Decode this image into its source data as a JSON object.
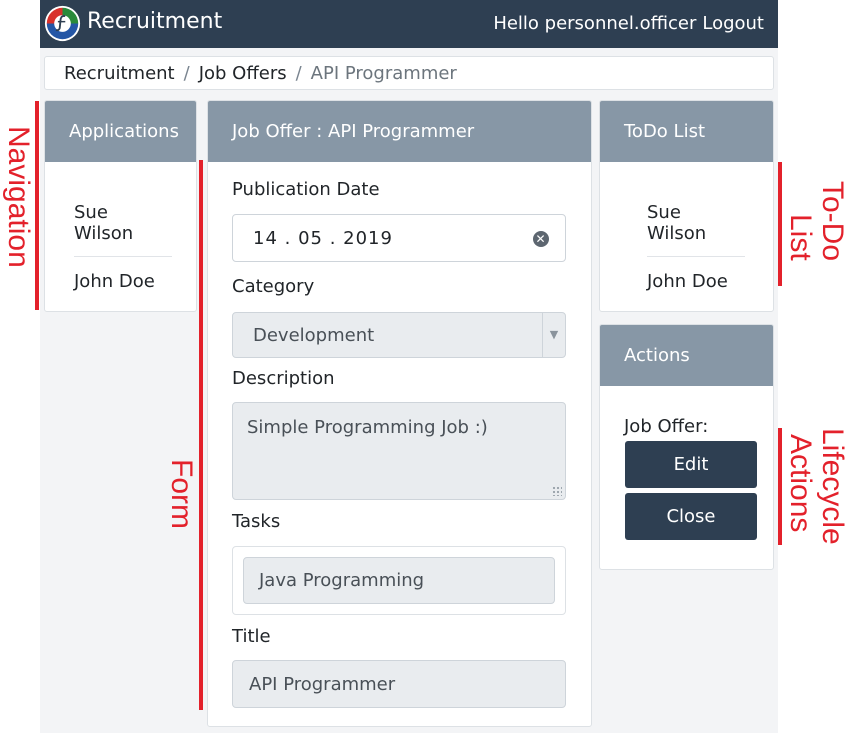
{
  "app": {
    "title": "Recruitment"
  },
  "header": {
    "greeting": "Hello personnel.officer",
    "logout_label": "Logout"
  },
  "breadcrumb": {
    "items": [
      "Recruitment",
      "Job Offers"
    ],
    "current": "API Programmer"
  },
  "navigation": {
    "header": "Applications",
    "items": [
      "Sue Wilson",
      "John Doe"
    ]
  },
  "form": {
    "header": "Job Offer : API Programmer",
    "publication_date_label": "Publication Date",
    "publication_date_value": "14 . 05 . 2019",
    "category_label": "Category",
    "category_value": "Development",
    "description_label": "Description",
    "description_value": "Simple Programming Job :)",
    "tasks_label": "Tasks",
    "tasks": [
      "Java Programming"
    ],
    "title_label": "Title",
    "title_value": "API Programmer"
  },
  "todo": {
    "header": "ToDo List",
    "items": [
      "Sue Wilson",
      "John Doe"
    ]
  },
  "actions": {
    "header": "Actions",
    "subject_label": "Job Offer:",
    "edit_label": "Edit",
    "close_label": "Close"
  },
  "annotations": {
    "navigation": "Navigation",
    "form": "Form",
    "todo_line1": "To-Do",
    "todo_line2": "List",
    "lifecycle_line1": "Lifecycle",
    "lifecycle_line2": "Actions"
  },
  "colors": {
    "navbar": "#2e3f52",
    "card_header": "#8797a6",
    "annotation": "#e3212b",
    "button": "#2e3f52"
  },
  "icons": {
    "logo": "app-logo-icon",
    "clear": "clear-icon",
    "select": "chevron-down-icon",
    "resize": "resize-grip-icon"
  }
}
